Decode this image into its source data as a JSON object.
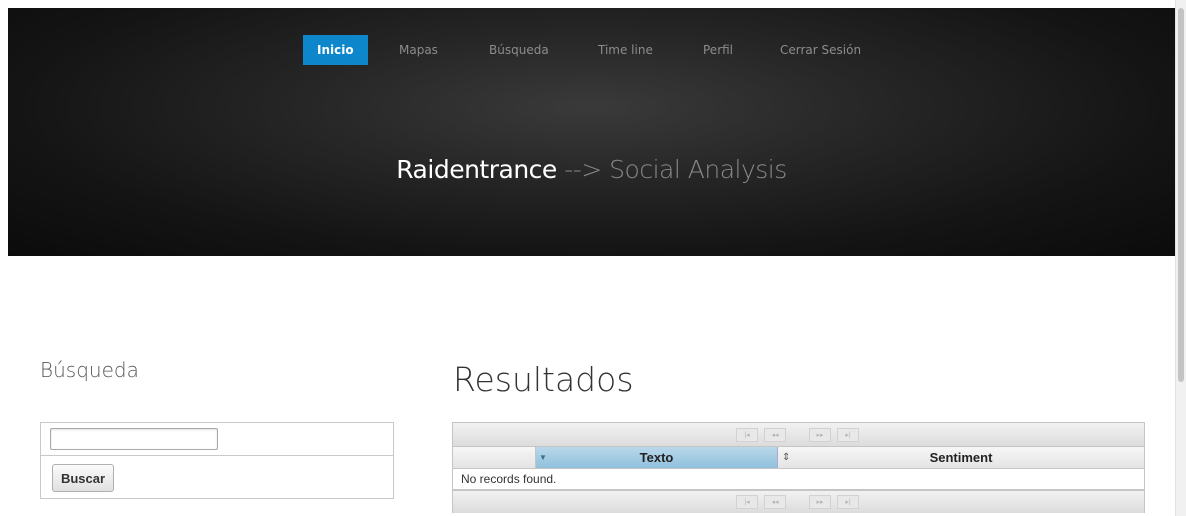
{
  "nav": {
    "items": [
      {
        "label": "Inicio",
        "active": true
      },
      {
        "label": "Mapas",
        "active": false
      },
      {
        "label": "Búsqueda",
        "active": false
      },
      {
        "label": "Time line",
        "active": false
      },
      {
        "label": "Perfil",
        "active": false
      },
      {
        "label": "Cerrar Sesión",
        "active": false
      }
    ]
  },
  "hero": {
    "brand": "Raidentrance",
    "subtitle": " --> Social Analysis"
  },
  "search": {
    "heading": "Búsqueda",
    "input_value": "",
    "button_label": "Buscar"
  },
  "results": {
    "heading": "Resultados",
    "columns": [
      "Texto",
      "Sentiment"
    ],
    "empty_message": "No records found.",
    "pager": {
      "first_icon": "first-page-icon",
      "prev_icon": "prev-page-icon",
      "next_icon": "next-page-icon",
      "last_icon": "last-page-icon"
    }
  },
  "colors": {
    "accent": "#0e86cc",
    "header_bg": "#1a1a1a",
    "sorted_column": "#a9cfe6"
  }
}
